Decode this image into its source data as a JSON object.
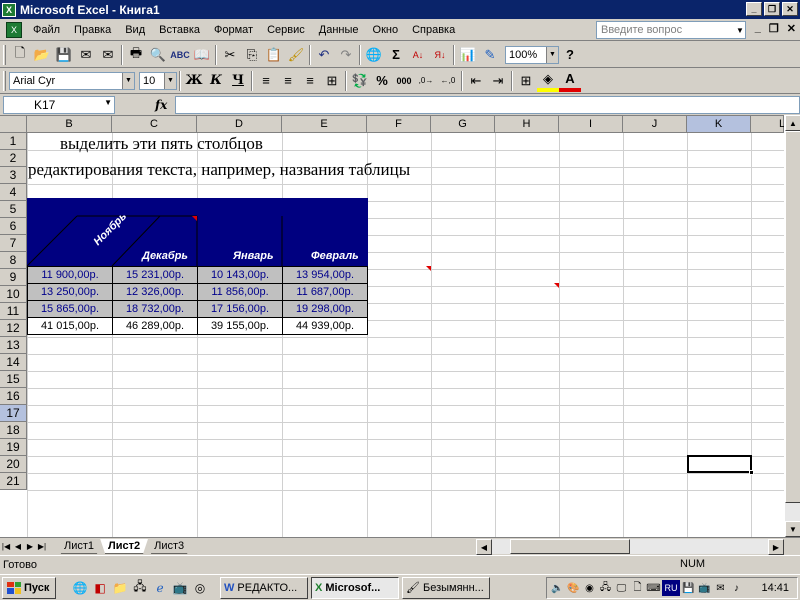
{
  "window": {
    "title": "Microsoft Excel - Книга1",
    "app_icon": "X"
  },
  "menu": {
    "items": [
      "Файл",
      "Правка",
      "Вид",
      "Вставка",
      "Формат",
      "Сервис",
      "Данные",
      "Окно",
      "Справка"
    ],
    "help_placeholder": "Введите вопрос"
  },
  "toolbar": {
    "zoom": "100%",
    "font_name": "Arial Cyr",
    "font_size": "10",
    "bold": "Ж",
    "italic": "К",
    "underline": "Ч",
    "percent": "%",
    "thousands": "000"
  },
  "formula_bar": {
    "name_box": "K17",
    "fx": "fx"
  },
  "sheet": {
    "columns": [
      "B",
      "C",
      "D",
      "E",
      "F",
      "G",
      "H",
      "I",
      "J",
      "K",
      "L"
    ],
    "rows": [
      "1",
      "2",
      "3",
      "4",
      "5",
      "6",
      "7",
      "8",
      "9",
      "10",
      "11",
      "12",
      "13",
      "14",
      "15",
      "16",
      "17",
      "18",
      "19",
      "20",
      "21"
    ],
    "row1_text": "выделить эти пять столбцов",
    "row2_text": "редактирования текста, например, названия таблицы",
    "headers": {
      "nov": "Ноябрь",
      "dec": "Декабрь",
      "jan": "Январь",
      "feb": "Февраль"
    },
    "data": [
      [
        "11 900,00р.",
        "15 231,00р.",
        "10 143,00р.",
        "13 954,00р."
      ],
      [
        "13 250,00р.",
        "12 326,00р.",
        "11 856,00р.",
        "11 687,00р."
      ],
      [
        "15 865,00р.",
        "18 732,00р.",
        "17 156,00р.",
        "19 298,00р."
      ],
      [
        "41 015,00р.",
        "46 289,00р.",
        "39 155,00р.",
        "44 939,00р."
      ]
    ],
    "active_cell": "K17"
  },
  "tabs": {
    "sheets": [
      "Лист1",
      "Лист2",
      "Лист3"
    ],
    "active": "Лист2"
  },
  "status": {
    "ready": "Готово",
    "num": "NUM"
  },
  "taskbar": {
    "start": "Пуск",
    "tasks": [
      "РЕДАКТО...",
      "Microsof...",
      "Безымянн..."
    ],
    "clock": "14:41",
    "lang": "RU"
  }
}
